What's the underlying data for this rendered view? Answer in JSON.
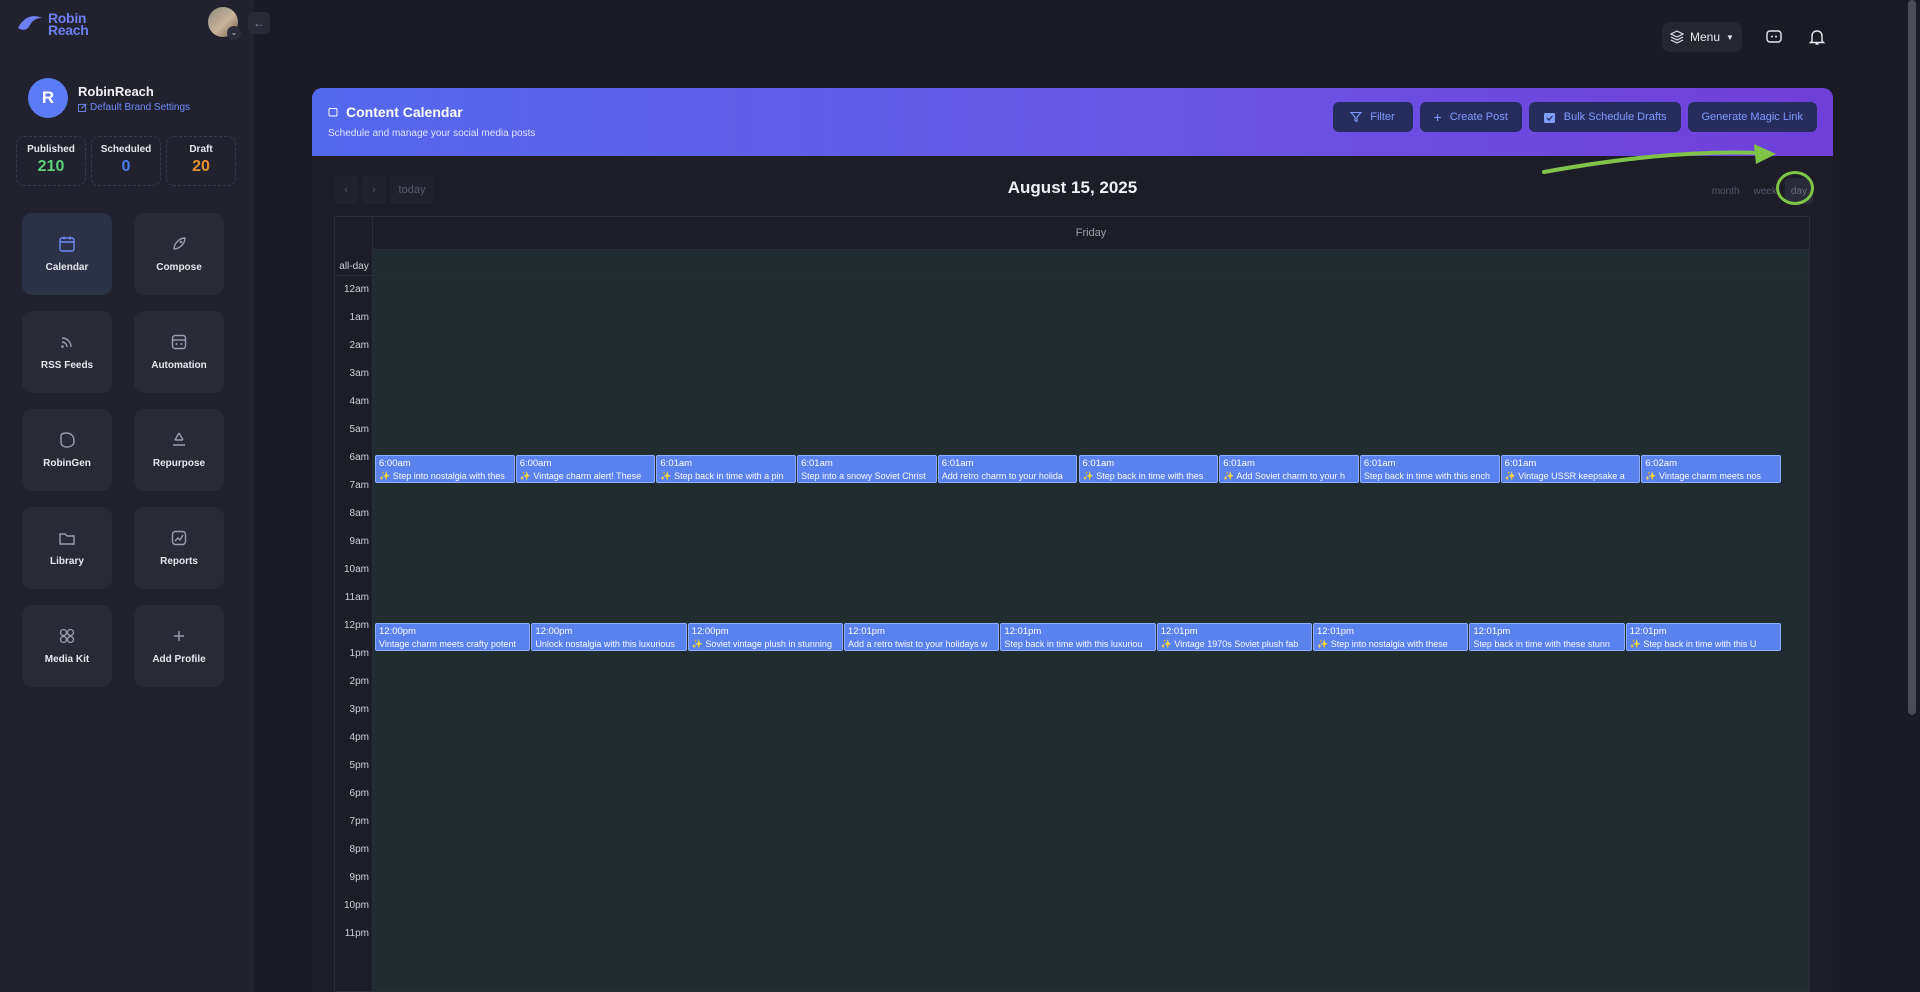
{
  "app": {
    "logo_text_line1": "Robin",
    "logo_text_line2": "Reach"
  },
  "profile": {
    "initial": "R",
    "name": "RobinReach",
    "brand_settings": "Default Brand Settings"
  },
  "stats": [
    {
      "label": "Published",
      "value": "210",
      "color": "#5ad17b"
    },
    {
      "label": "Scheduled",
      "value": "0",
      "color": "#4c7bf1"
    },
    {
      "label": "Draft",
      "value": "20",
      "color": "#e68f2e"
    }
  ],
  "nav": [
    {
      "label": "Calendar",
      "icon": "calendar-icon",
      "active": true
    },
    {
      "label": "Compose",
      "icon": "rocket-icon"
    },
    {
      "label": "RSS Feeds",
      "icon": "rss-icon"
    },
    {
      "label": "Automation",
      "icon": "automation-icon"
    },
    {
      "label": "RobinGen",
      "icon": "robingen-icon"
    },
    {
      "label": "Repurpose",
      "icon": "recycle-icon"
    },
    {
      "label": "Library",
      "icon": "folder-icon"
    },
    {
      "label": "Reports",
      "icon": "chart-icon"
    },
    {
      "label": "Media Kit",
      "icon": "grid-icon"
    },
    {
      "label": "Add Profile",
      "icon": "plus-icon"
    }
  ],
  "topbar": {
    "menu_label": "Menu"
  },
  "calendar": {
    "title": "Content Calendar",
    "subtitle": "Schedule and manage your social media posts",
    "buttons": {
      "filter": "Filter",
      "create_post": "Create Post",
      "bulk": "Bulk Schedule Drafts",
      "magic": "Generate Magic Link"
    },
    "today_label": "today",
    "date_title": "August 15, 2025",
    "views": {
      "month": "month",
      "week": "week",
      "day": "day"
    },
    "active_view": "day",
    "day_name": "Friday",
    "allday_label": "all-day",
    "hours": [
      "12am",
      "1am",
      "2am",
      "3am",
      "4am",
      "5am",
      "6am",
      "7am",
      "8am",
      "9am",
      "10am",
      "11am",
      "12pm",
      "1pm",
      "2pm",
      "3pm",
      "4pm",
      "5pm",
      "6pm",
      "7pm",
      "8pm",
      "9pm",
      "10pm",
      "11pm"
    ],
    "morning_events": [
      {
        "time": "6:00am",
        "text": "✨ Step into nostalgia with thes"
      },
      {
        "time": "6:00am",
        "text": "✨ Vintage charm alert! These"
      },
      {
        "time": "6:01am",
        "text": "✨ Step back in time with a pin"
      },
      {
        "time": "6:01am",
        "text": "Step into a snowy Soviet Christ"
      },
      {
        "time": "6:01am",
        "text": "Add retro charm to your holida"
      },
      {
        "time": "6:01am",
        "text": "✨ Step back in time with thes"
      },
      {
        "time": "6:01am",
        "text": "✨ Add Soviet charm to your h"
      },
      {
        "time": "6:01am",
        "text": "Step back in time with this ench"
      },
      {
        "time": "6:01am",
        "text": "✨ Vintage USSR keepsake a"
      },
      {
        "time": "6:02am",
        "text": "✨ Vintage charm meets nos"
      }
    ],
    "noon_events": [
      {
        "time": "12:00pm",
        "text": "Vintage charm meets crafty potent"
      },
      {
        "time": "12:00pm",
        "text": "Unlock nostalgia with this luxurious"
      },
      {
        "time": "12:00pm",
        "text": "✨ Soviet vintage plush in stunning"
      },
      {
        "time": "12:01pm",
        "text": "Add a retro twist to your holidays w"
      },
      {
        "time": "12:01pm",
        "text": "Step back in time with this luxuriou"
      },
      {
        "time": "12:01pm",
        "text": "✨ Vintage 1970s Soviet plush fab"
      },
      {
        "time": "12:01pm",
        "text": "✨ Step into nostalgia with these"
      },
      {
        "time": "12:01pm",
        "text": "Step back in time with these stunn"
      },
      {
        "time": "12:01pm",
        "text": "✨ Step back in time with this U"
      }
    ]
  }
}
